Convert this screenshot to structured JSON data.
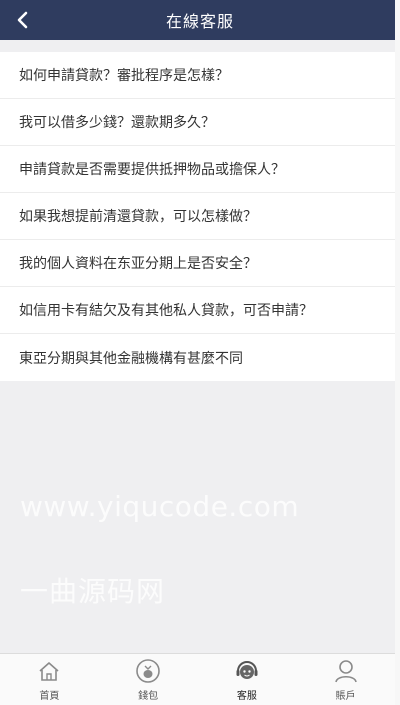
{
  "header": {
    "title": "在線客服"
  },
  "faq": [
    "如何申請貸款？審批程序是怎樣？",
    "我可以借多少錢？還款期多久？",
    "申請貸款是否需要提供抵押物品或擔保人？",
    "如果我想提前清還貸款，可以怎樣做？",
    "我的個人資料在东亚分期上是否安全？",
    "如信用卡有結欠及有其他私人貸款，可否申請？",
    "東亞分期與其他金融機構有甚麼不同"
  ],
  "watermark": {
    "line1": "www.yiqucode.com",
    "line2": "一曲源码网"
  },
  "tabbar": {
    "items": [
      {
        "label": "首頁",
        "icon": "home-icon"
      },
      {
        "label": "錢包",
        "icon": "wallet-icon"
      },
      {
        "label": "客服",
        "icon": "customer-service-icon",
        "active": true
      },
      {
        "label": "賬戶",
        "icon": "account-icon"
      }
    ]
  },
  "colors": {
    "header_bg": "#2f3c5f",
    "page_bg": "#efeff1",
    "text": "#333333"
  }
}
